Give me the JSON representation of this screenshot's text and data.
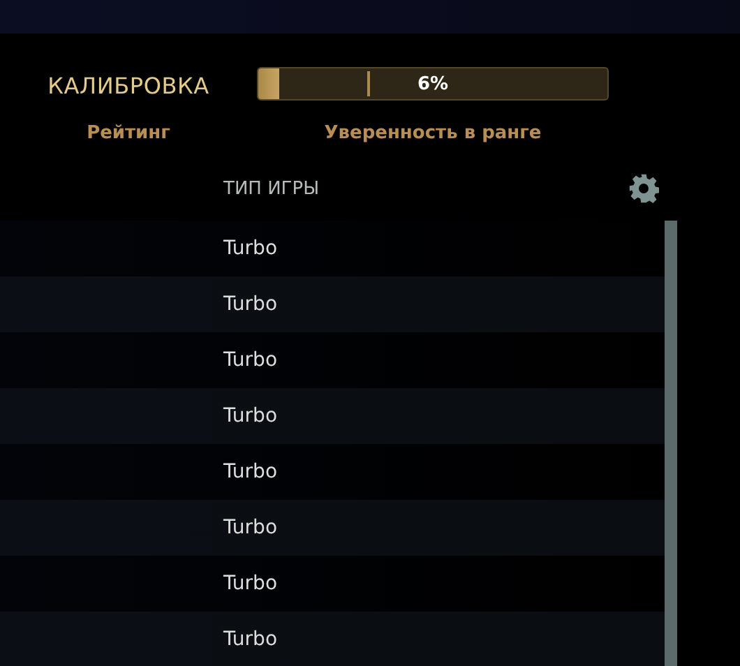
{
  "calibration": {
    "title": "КАЛИБРОВКА",
    "rating_label": "Рейтинг",
    "confidence": {
      "level": 0.06,
      "reading": "6%",
      "label": "Уверенность в ранге"
    }
  },
  "table": {
    "columns": [
      "ТИП ИГРЫ"
    ],
    "rows": [
      {
        "game_type": "Turbo"
      },
      {
        "game_type": "Turbo"
      },
      {
        "game_type": "Turbo"
      },
      {
        "game_type": "Turbo"
      },
      {
        "game_type": "Turbo"
      },
      {
        "game_type": "Turbo"
      },
      {
        "game_type": "Turbo"
      },
      {
        "game_type": "Turbo"
      }
    ]
  }
}
